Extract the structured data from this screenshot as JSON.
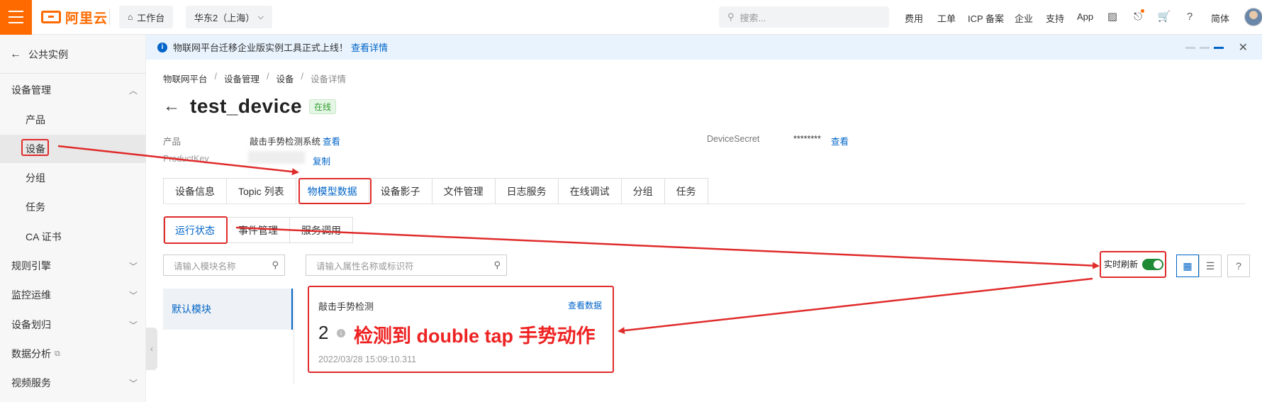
{
  "topbar": {
    "logo": "阿里云",
    "workbench": "工作台",
    "region": "华东2（上海）",
    "search_placeholder": "搜索...",
    "links": [
      "费用",
      "工单",
      "ICP 备案",
      "企业",
      "支持",
      "App"
    ],
    "lang": "简体"
  },
  "sidebar": {
    "back_label": "公共实例",
    "items": [
      {
        "label": "设备管理",
        "level": 1,
        "chevron": "up"
      },
      {
        "label": "产品",
        "level": 2
      },
      {
        "label": "设备",
        "level": 2,
        "active": true
      },
      {
        "label": "分组",
        "level": 2
      },
      {
        "label": "任务",
        "level": 2
      },
      {
        "label": "CA 证书",
        "level": 2
      },
      {
        "label": "规则引擎",
        "level": 1,
        "chevron": "down"
      },
      {
        "label": "监控运维",
        "level": 1,
        "chevron": "down"
      },
      {
        "label": "设备划归",
        "level": 1,
        "chevron": "down"
      },
      {
        "label": "数据分析",
        "level": 1,
        "external": true
      },
      {
        "label": "视频服务",
        "level": 1,
        "chevron": "down"
      }
    ]
  },
  "notice": {
    "text": "物联网平台迁移企业版实例工具正式上线！",
    "link": "查看详情"
  },
  "breadcrumb": [
    "物联网平台",
    "设备管理",
    "设备",
    "设备详情"
  ],
  "device": {
    "name": "test_device",
    "status": "在线",
    "product_label": "产品",
    "product_value": "敲击手势检测系统",
    "product_link": "查看",
    "secret_label": "DeviceSecret",
    "secret_value": "********",
    "secret_link": "查看",
    "pk_label": "ProductKey",
    "pk_link": "复制"
  },
  "tabs": [
    "设备信息",
    "Topic 列表",
    "物模型数据",
    "设备影子",
    "文件管理",
    "日志服务",
    "在线调试",
    "分组",
    "任务"
  ],
  "active_tab": "物模型数据",
  "subtabs": [
    "运行状态",
    "事件管理",
    "服务调用"
  ],
  "active_subtab": "运行状态",
  "module_search_placeholder": "请输入模块名称",
  "attr_search_placeholder": "请输入属性名称或标识符",
  "module_default": "默认模块",
  "realtime_refresh": "实时刷新",
  "help": "?",
  "card": {
    "name": "敲击手势检测",
    "view_link": "查看数据",
    "value": "2",
    "annotation": "检测到 double tap 手势动作",
    "timestamp": "2022/03/28 15:09:10.311"
  },
  "colors": {
    "accent": "#0064c8",
    "brand": "#ff6a00",
    "annotation": "#e02b2b",
    "toggle_on": "#1e8a36"
  }
}
